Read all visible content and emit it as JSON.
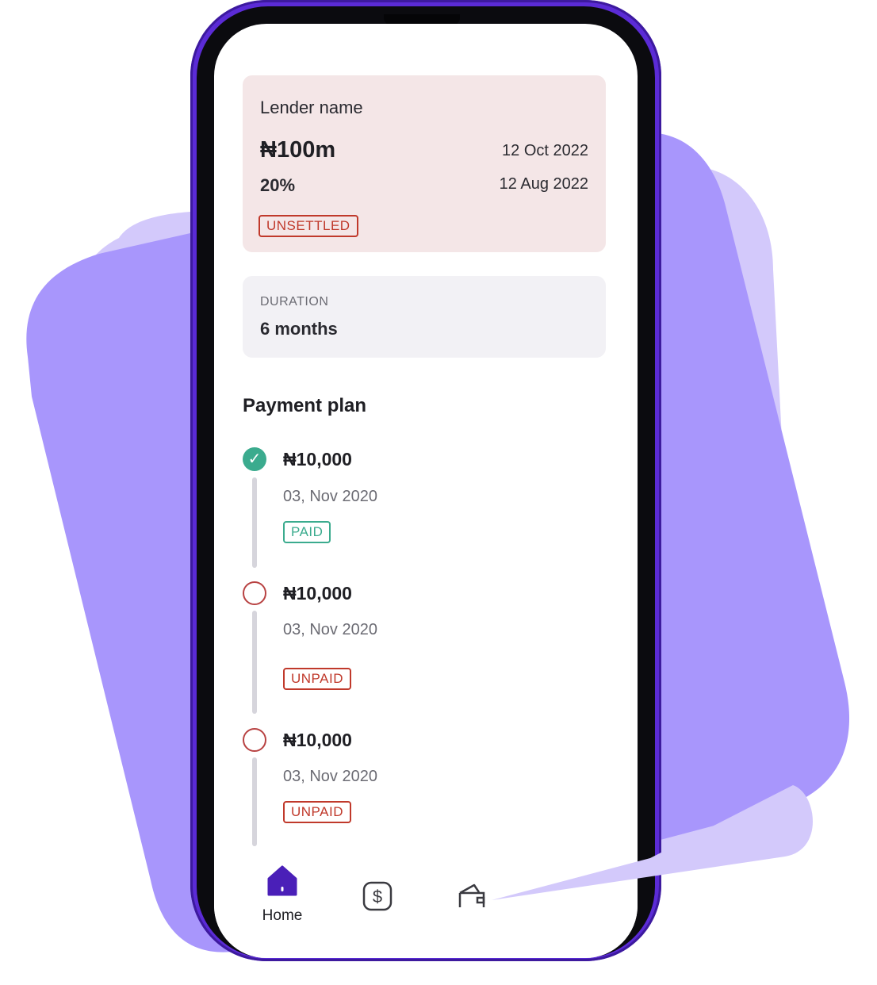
{
  "loan": {
    "lender_name": "Lender name",
    "amount": "₦100m",
    "date_1": "12 Oct 2022",
    "rate": "20%",
    "date_2": "12 Aug 2022",
    "status": "UNSETTLED"
  },
  "duration": {
    "label": "DURATION",
    "value": "6 months"
  },
  "payment_plan": {
    "title": "Payment plan",
    "items": [
      {
        "amount": "₦10,000",
        "date": "03, Nov 2020",
        "status": "PAID"
      },
      {
        "amount": "₦10,000",
        "date": "03, Nov 2020",
        "status": "UNPAID"
      },
      {
        "amount": "₦10,000",
        "date": "03, Nov 2020",
        "status": "UNPAID"
      }
    ]
  },
  "nav": {
    "home_label": "Home",
    "items": [
      "home-icon",
      "dollar-icon",
      "wallet-icon"
    ]
  },
  "colors": {
    "accent": "#5b2bd6",
    "paid": "#3bab8e",
    "unpaid": "#c0392b",
    "card_pink": "#f4e6e7",
    "card_gray": "#f2f1f5"
  }
}
